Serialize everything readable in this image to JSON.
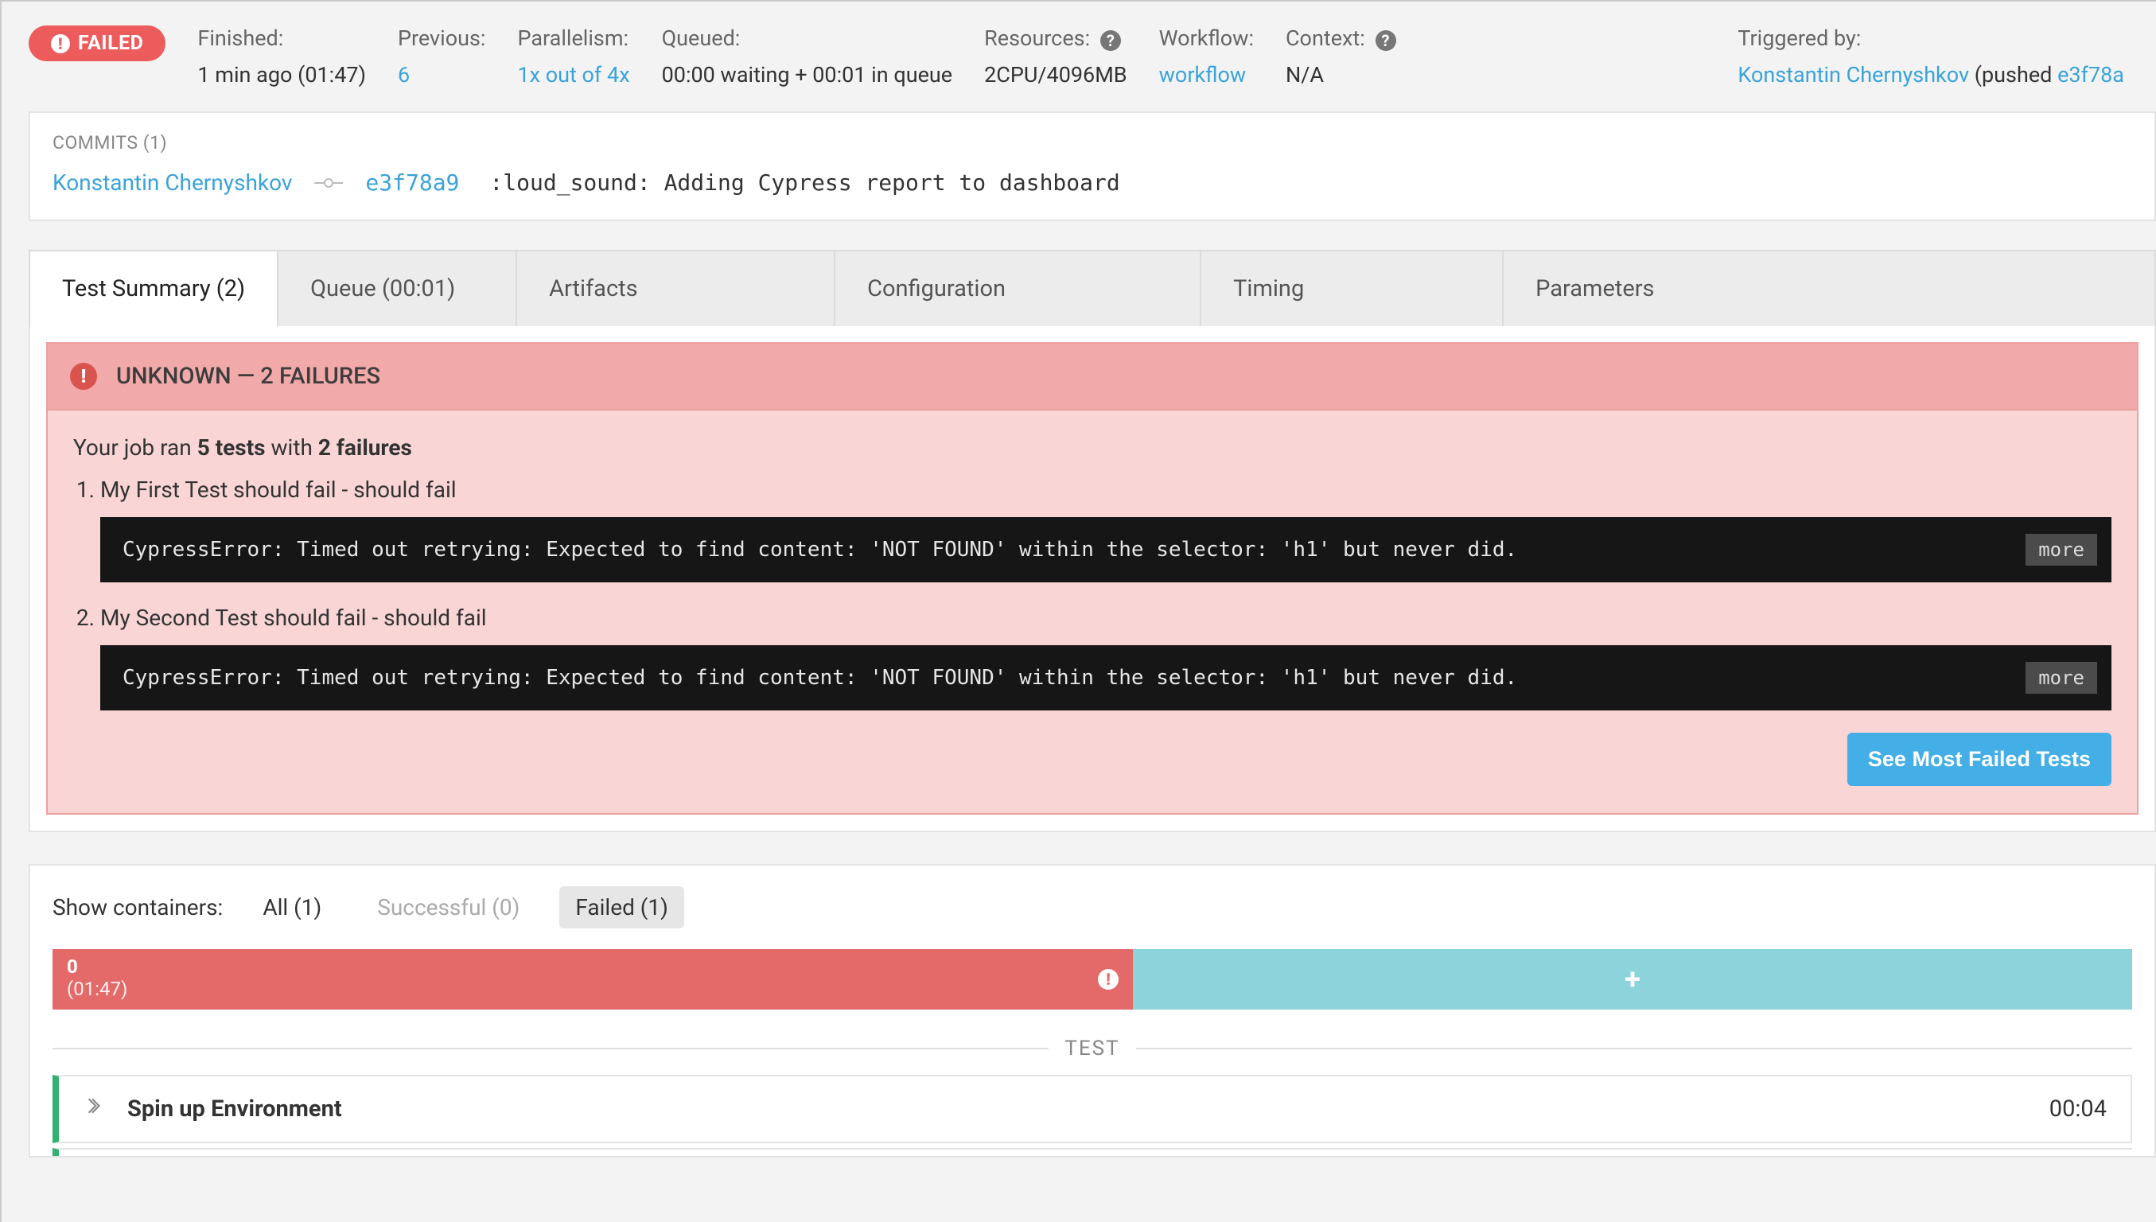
{
  "status_badge": "FAILED",
  "meta": {
    "finished": {
      "label": "Finished:",
      "value": "1 min ago (01:47)"
    },
    "previous": {
      "label": "Previous:",
      "value": "6"
    },
    "parallelism": {
      "label": "Parallelism:",
      "value": "1x out of 4x"
    },
    "queued": {
      "label": "Queued:",
      "value": "00:00 waiting + 00:01 in queue"
    },
    "resources": {
      "label": "Resources:",
      "value": "2CPU/4096MB"
    },
    "workflow": {
      "label": "Workflow:",
      "value": "workflow"
    },
    "context": {
      "label": "Context:",
      "value": "N/A"
    },
    "triggered": {
      "label": "Triggered by:",
      "name": "Konstantin Chernyshkov",
      "action": " (pushed ",
      "hash": "e3f78a"
    }
  },
  "commits": {
    "title": "COMMITS (1)",
    "author": "Konstantin Chernyshkov",
    "hash": "e3f78a9",
    "message": ":loud_sound: Adding Cypress report to dashboard"
  },
  "tabs": {
    "summary": "Test Summary (2)",
    "queue": "Queue (00:01)",
    "artifacts": "Artifacts",
    "configuration": "Configuration",
    "timing": "Timing",
    "parameters": "Parameters"
  },
  "failure": {
    "banner": "UNKNOWN — 2 FAILURES",
    "line_pre": "Your job ran ",
    "tests_count": "5 tests",
    "line_mid": " with ",
    "fail_count": "2 failures",
    "items": [
      {
        "title": "My First Test should fail - should fail",
        "error": "CypressError: Timed out retrying: Expected to find content: 'NOT FOUND' within the selector: 'h1' but never did."
      },
      {
        "title": "My Second Test should fail - should fail",
        "error": "CypressError: Timed out retrying: Expected to find content: 'NOT FOUND' within the selector: 'h1' but never did."
      }
    ],
    "more_label": "more",
    "see_failed_btn": "See Most Failed Tests"
  },
  "containers": {
    "label": "Show containers:",
    "all": "All (1)",
    "successful": "Successful (0)",
    "failed": "Failed (1)",
    "bar0": {
      "num": "0",
      "time": "(01:47)"
    },
    "sep": "TEST",
    "step0": {
      "name": "Spin up Environment",
      "duration": "00:04"
    }
  }
}
